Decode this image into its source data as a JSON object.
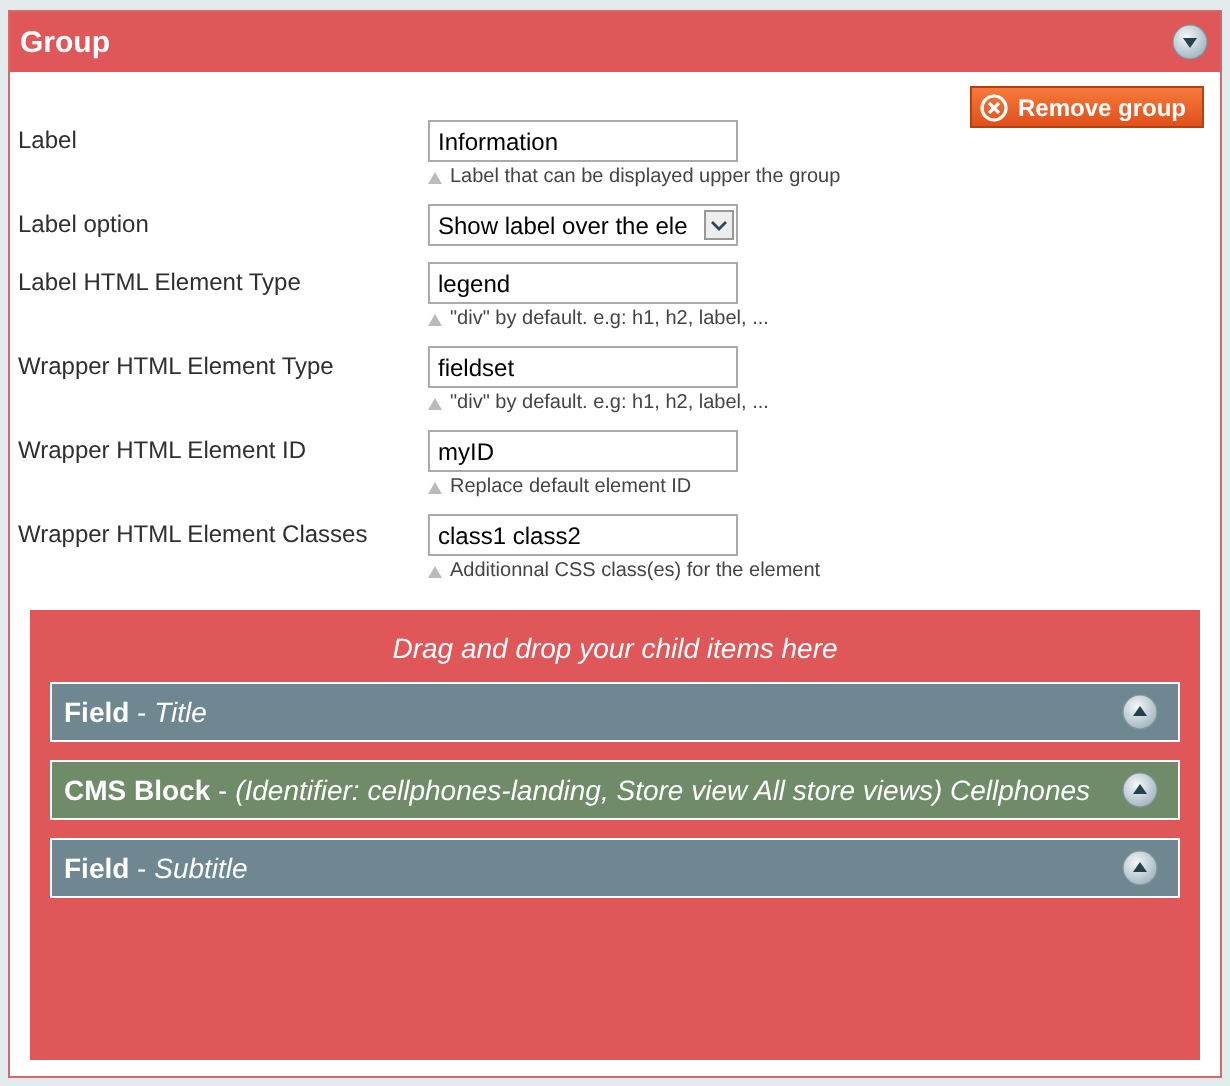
{
  "header": {
    "title": "Group"
  },
  "remove_button": {
    "label": "Remove group"
  },
  "fields": [
    {
      "label": "Label",
      "kind": "text",
      "value": "Information",
      "hint": "Label that can be displayed upper the group"
    },
    {
      "label": "Label option",
      "kind": "select",
      "value": "Show label over the ele"
    },
    {
      "label": "Label HTML Element Type",
      "kind": "text",
      "value": "legend",
      "hint": "\"div\" by default. e.g: h1, h2, label, ..."
    },
    {
      "label": "Wrapper HTML Element Type",
      "kind": "text",
      "value": "fieldset",
      "hint": "\"div\" by default. e.g: h1, h2, label, ..."
    },
    {
      "label": "Wrapper HTML Element ID",
      "kind": "text",
      "value": "myID",
      "hint": "Replace default element ID"
    },
    {
      "label": "Wrapper HTML Element Classes",
      "kind": "text",
      "value": "class1 class2",
      "hint": "Additionnal CSS class(es) for the element"
    }
  ],
  "drop_zone": {
    "hint": "Drag and drop your child items here",
    "children": [
      {
        "kind": "field",
        "label": "**Field** - *Title*"
      },
      {
        "kind": "cms_block",
        "label": "**CMS Block** - *(Identifier: cellphones-landing, Store view All store views) Cellphones*"
      },
      {
        "kind": "field",
        "label": "**Field** - *Subtitle*"
      }
    ]
  }
}
